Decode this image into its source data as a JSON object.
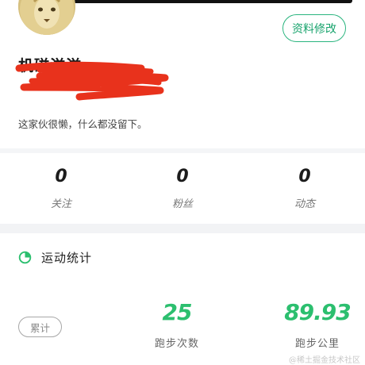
{
  "profile": {
    "name": "机磁滋滋",
    "bio": "这家伙很懒，什么都没留下。",
    "edit_label": "资料修改"
  },
  "stats": [
    {
      "value": "0",
      "label": "关注"
    },
    {
      "value": "0",
      "label": "粉丝"
    },
    {
      "value": "0",
      "label": "动态"
    }
  ],
  "sports": {
    "title": "运动统计",
    "filter_label": "累计",
    "metrics": [
      {
        "value": "25",
        "label": "跑步次数"
      },
      {
        "value": "89.93",
        "label": "跑步公里"
      }
    ]
  },
  "watermark": "@稀土掘金技术社区",
  "colors": {
    "accent": "#2cbf6f",
    "edit_border": "#2bb57f",
    "redaction": "#e8321c"
  },
  "icons": {
    "section_icon": "pie-chart-icon"
  }
}
